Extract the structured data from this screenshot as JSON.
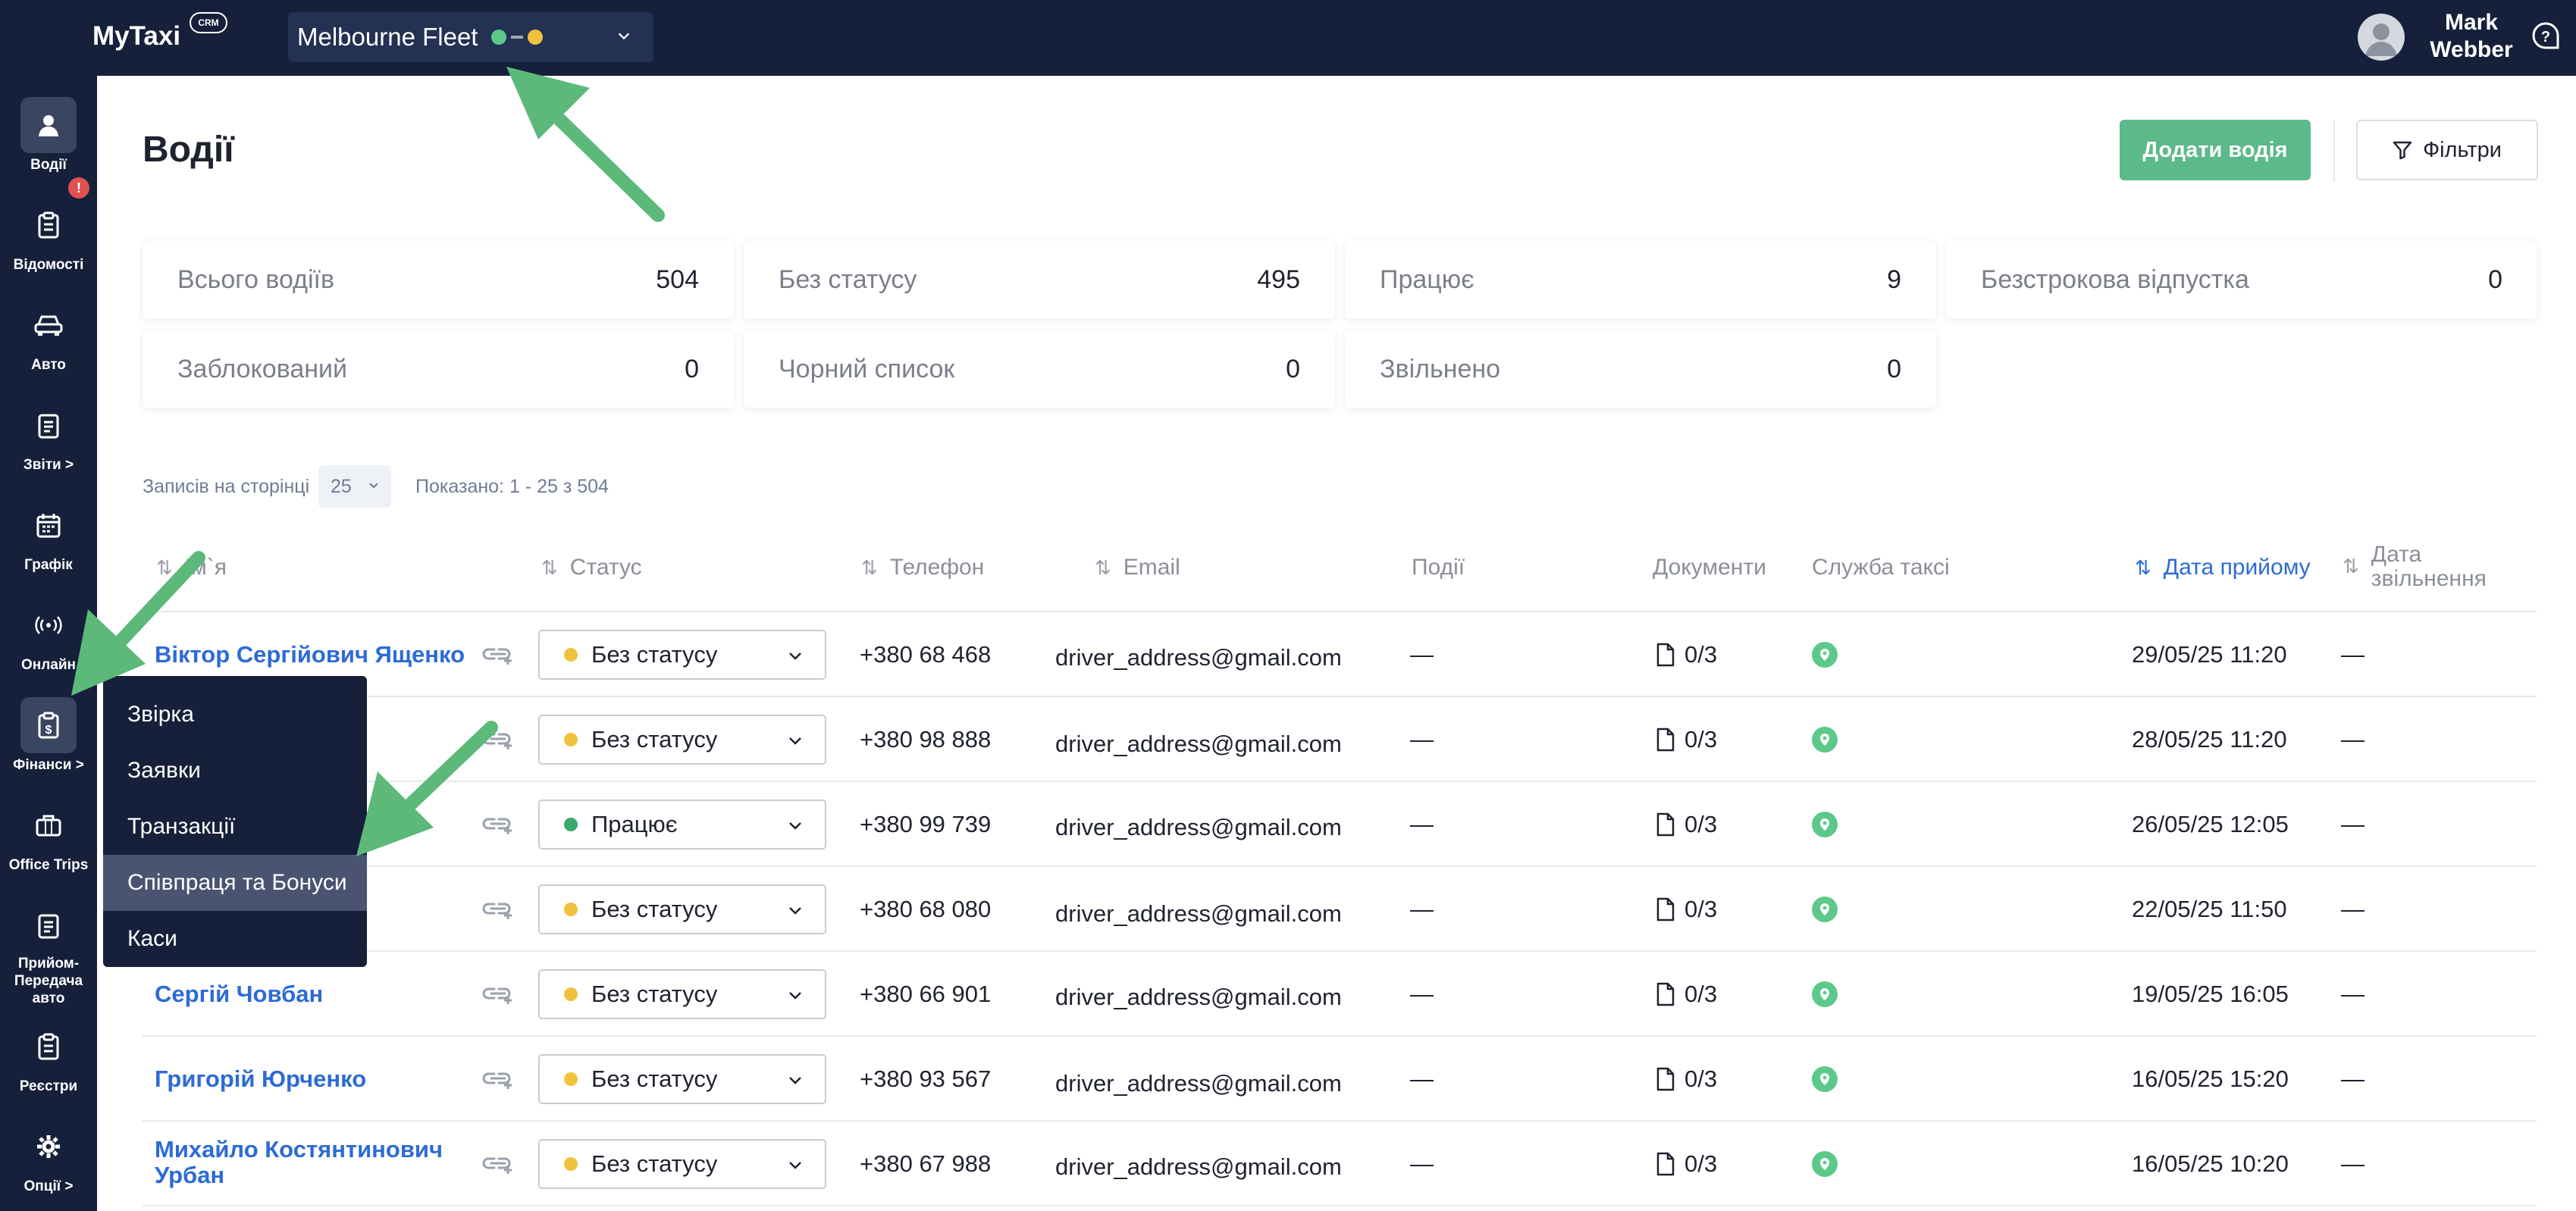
{
  "app": {
    "logo": "MyTaxi",
    "logo_badge": "CRM"
  },
  "fleet": {
    "name": "Melbourne Fleet",
    "colors": [
      "#5cc98a",
      "#f0c23c"
    ]
  },
  "user": {
    "name": "Mark Webber"
  },
  "sidebar": {
    "items": [
      {
        "label": "Водії",
        "icon": "person-icon",
        "active": true
      },
      {
        "label": "Відомості",
        "icon": "clipboard-icon",
        "badge": "!"
      },
      {
        "label": "Авто",
        "icon": "car-icon"
      },
      {
        "label": "Звіти >",
        "icon": "report-icon"
      },
      {
        "label": "Графік",
        "icon": "calendar-icon"
      },
      {
        "label": "Онлайн",
        "icon": "broadcast-icon"
      },
      {
        "label": "Фінанси >",
        "icon": "finance-icon",
        "hovered": true
      },
      {
        "label": "Office Trips",
        "icon": "briefcase-icon"
      },
      {
        "label": "Прийом-Передача авто",
        "icon": "transfer-icon"
      },
      {
        "label": "Реєстри",
        "icon": "registry-icon"
      },
      {
        "label": "Опції >",
        "icon": "gear-icon"
      }
    ]
  },
  "finance_menu": {
    "items": [
      "Звірка",
      "Заявки",
      "Транзакції",
      "Співпраця та Бонуси",
      "Каси"
    ],
    "highlighted": "Співпраця та Бонуси"
  },
  "page": {
    "title": "Водії",
    "add_button": "Додати водія",
    "filters_button": "Фільтри"
  },
  "stats": [
    {
      "label": "Всього водіїв",
      "value": "504"
    },
    {
      "label": "Без статусу",
      "value": "495"
    },
    {
      "label": "Працює",
      "value": "9"
    },
    {
      "label": "Безстрокова відпустка",
      "value": "0"
    },
    {
      "label": "Заблокований",
      "value": "0"
    },
    {
      "label": "Чорний список",
      "value": "0"
    },
    {
      "label": "Звільнено",
      "value": "0"
    }
  ],
  "pagination": {
    "per_page_label": "Записів на сторінці",
    "per_page_value": "25",
    "shown_text": "Показано: 1 - 25 з 504"
  },
  "table": {
    "headers": {
      "name": "Ім`я",
      "status": "Статус",
      "phone": "Телефон",
      "email": "Email",
      "events": "Події",
      "documents": "Документи",
      "taxi_service": "Служба таксі",
      "hire_date": "Дата прийому",
      "dismissal_date": "Дата звільнення"
    },
    "rows": [
      {
        "name": "Віктор Сергійович Ященко",
        "status": "Без статусу",
        "status_color": "#f0c23c",
        "phone": "+380 68 468",
        "email": "driver_address@gmail.com",
        "events": "—",
        "documents": "0/3",
        "hire_date": "29/05/25 11:20",
        "dismissal_date": "—"
      },
      {
        "name": "",
        "status": "Без статусу",
        "status_color": "#f0c23c",
        "phone": "+380 98 888",
        "email": "driver_address@gmail.com",
        "events": "—",
        "documents": "0/3",
        "hire_date": "28/05/25 11:20",
        "dismissal_date": "—"
      },
      {
        "name": "",
        "status": "Працює",
        "status_color": "#3aa86b",
        "phone": "+380 99 739",
        "email": "driver_address@gmail.com",
        "events": "—",
        "documents": "0/3",
        "hire_date": "26/05/25 12:05",
        "dismissal_date": "—"
      },
      {
        "name": "",
        "status": "Без статусу",
        "status_color": "#f0c23c",
        "phone": "+380 68 080",
        "email": "driver_address@gmail.com",
        "events": "—",
        "documents": "0/3",
        "hire_date": "22/05/25 11:50",
        "dismissal_date": "—"
      },
      {
        "name": "Сергій Човбан",
        "status": "Без статусу",
        "status_color": "#f0c23c",
        "phone": "+380 66 901",
        "email": "driver_address@gmail.com",
        "events": "—",
        "documents": "0/3",
        "hire_date": "19/05/25 16:05",
        "dismissal_date": "—"
      },
      {
        "name": "Григорій Юрченко",
        "status": "Без статусу",
        "status_color": "#f0c23c",
        "phone": "+380 93 567",
        "email": "driver_address@gmail.com",
        "events": "—",
        "documents": "0/3",
        "hire_date": "16/05/25 15:20",
        "dismissal_date": "—"
      },
      {
        "name": "Михайло Костянтинович Урбан",
        "status": "Без статусу",
        "status_color": "#f0c23c",
        "phone": "+380 67 988",
        "email": "driver_address@gmail.com",
        "events": "—",
        "documents": "0/3",
        "hire_date": "16/05/25 10:20",
        "dismissal_date": "—"
      }
    ]
  },
  "annotation_color": "#5cb97a"
}
